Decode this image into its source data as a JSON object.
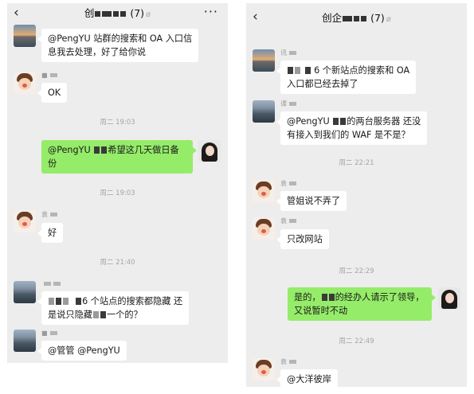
{
  "left": {
    "title": "创",
    "count": "(7)",
    "messages": [
      {
        "line1": "@PengYU 站群的搜索和 OA 入口信",
        "line2": "息我去处理，好了给你说"
      },
      {
        "text": "OK"
      },
      {
        "time": "周二 19:03"
      },
      {
        "line1a": "@PengYU",
        "line1b": "希望这几天做日备",
        "line2": "份"
      },
      {
        "time": "周二 19:03"
      },
      {
        "text": "好"
      },
      {
        "time": "周二 21:40"
      },
      {
        "line1": "6 个站点的搜索都隐藏 还",
        "line2a": "是说只隐藏",
        "line2b": "一个的？"
      },
      {
        "text": "@管管  @PengYU"
      }
    ]
  },
  "right": {
    "title": "创企",
    "count": "(7)",
    "messages": [
      {
        "line1": "6 个新站点的搜索和 OA",
        "line2": "入口都已经去掉了"
      },
      {
        "line1a": "@PengYU",
        "line1b": "的两台服务器 还没",
        "line2": "有接入到我们的 WAF 是不是？"
      },
      {
        "time": "周二 22:21"
      },
      {
        "text": "管姐说不弄了"
      },
      {
        "text": "只改网站"
      },
      {
        "time": "周二 22:29"
      },
      {
        "line1a": "是的，",
        "line1b": "的经办人请示了领导，",
        "line2": "又说暂时不动"
      },
      {
        "time": "周二 22:49"
      },
      {
        "text": "@大洋彼岸"
      }
    ]
  },
  "icons": {
    "back": "‹",
    "more": "···",
    "mute": "ø"
  },
  "colors": {
    "panel_bg": "#ededed",
    "bubble_in": "#ffffff",
    "bubble_out": "#95ec69"
  }
}
